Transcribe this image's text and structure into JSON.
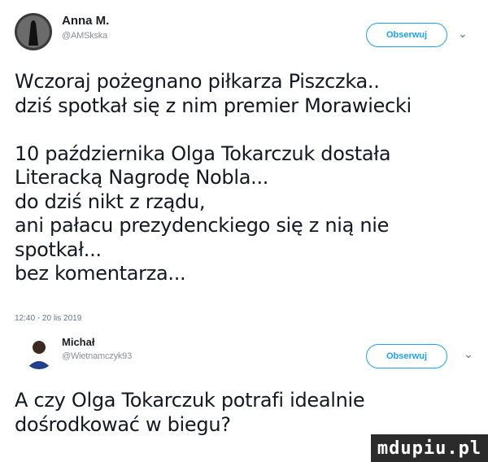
{
  "tweet1": {
    "author_name": "Anna M.",
    "author_handle": "@AMSkska",
    "follow_label": "Obserwuj",
    "text": "Wczoraj pożegnano piłkarza Piszczka..\ndziś spotkał się z nim  premier Morawiecki\n\n10 października Olga Tokarczuk dostała\nLiteracką Nagrodę Nobla...\ndo dziś nikt z rządu,\nani pałacu prezydenckiego się z nią nie\nspotkał...\nbez komentarza...",
    "timestamp": "12:40 - 20 lis 2019"
  },
  "tweet2": {
    "author_name": "Michał",
    "author_handle": "@Wietnamczyk93",
    "follow_label": "Obserwuj",
    "text": "A czy Olga Tokarczuk potrafi idealnie\ndośrodkować w biegu?"
  },
  "watermark": "mdupiu.pl",
  "icons": {
    "menu": "chevron-down-icon"
  },
  "colors": {
    "accent": "#1da1f2",
    "text": "#141823",
    "muted": "#657786"
  }
}
